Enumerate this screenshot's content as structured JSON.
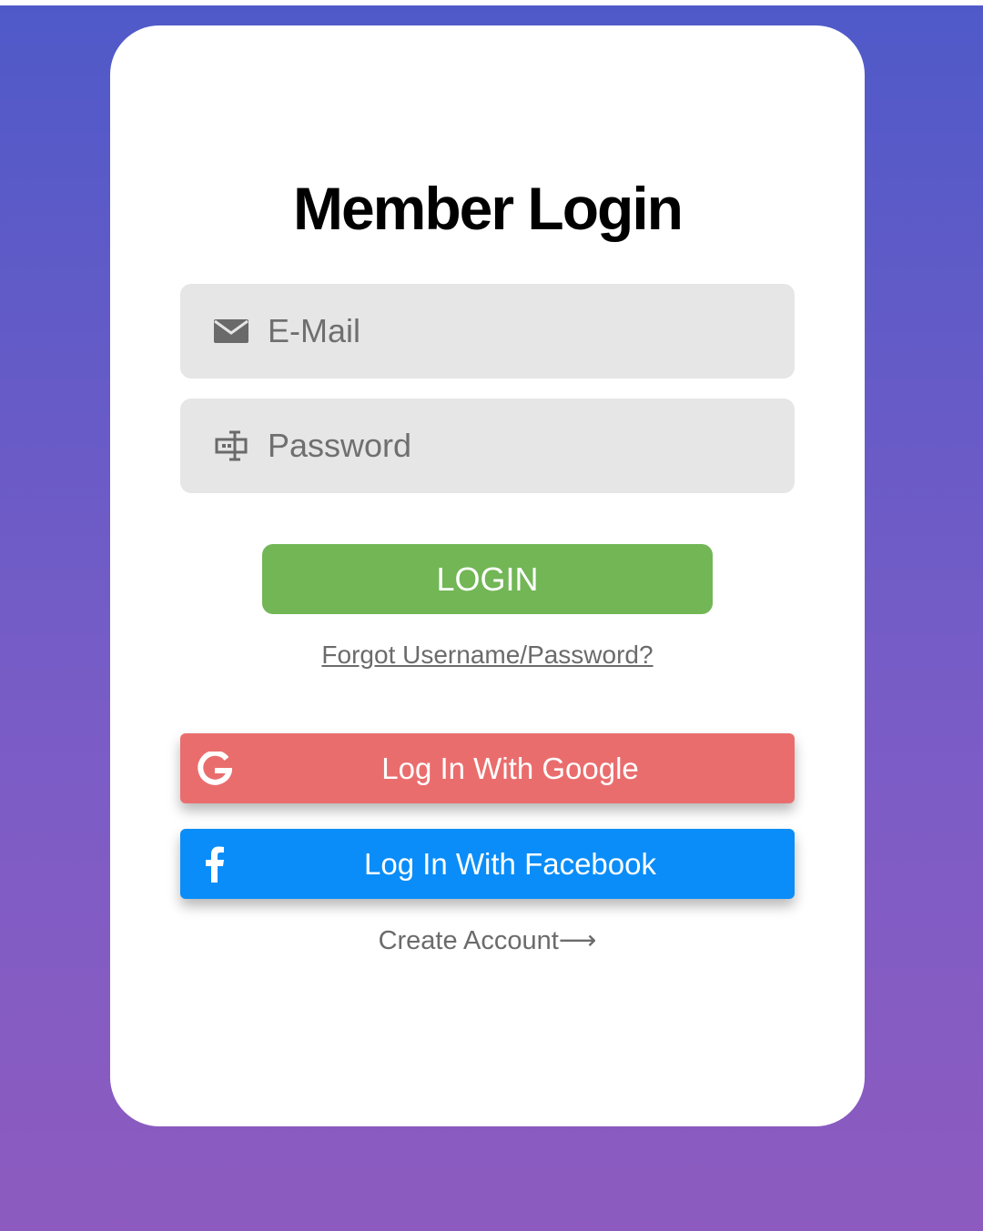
{
  "colors": {
    "background_top": "#4f5ac8",
    "background_bottom": "#8d5bbf",
    "login_button": "#72b656",
    "google_button": "#ea6d6d",
    "facebook_button": "#0a8df8",
    "field_background": "#e6e6e6"
  },
  "card": {
    "title": "Member Login",
    "email": {
      "icon": "envelope-icon",
      "placeholder": "E-Mail",
      "value": ""
    },
    "password": {
      "icon": "password-cursor-icon",
      "placeholder": "Password",
      "value": ""
    },
    "login_button": "LOGIN",
    "forgot_link": "Forgot Username/Password?",
    "google_button": {
      "icon": "google-icon",
      "label": "Log In With Google"
    },
    "facebook_button": {
      "icon": "facebook-icon",
      "label": "Log In With Facebook"
    },
    "create_account": "Create Account⟶"
  }
}
